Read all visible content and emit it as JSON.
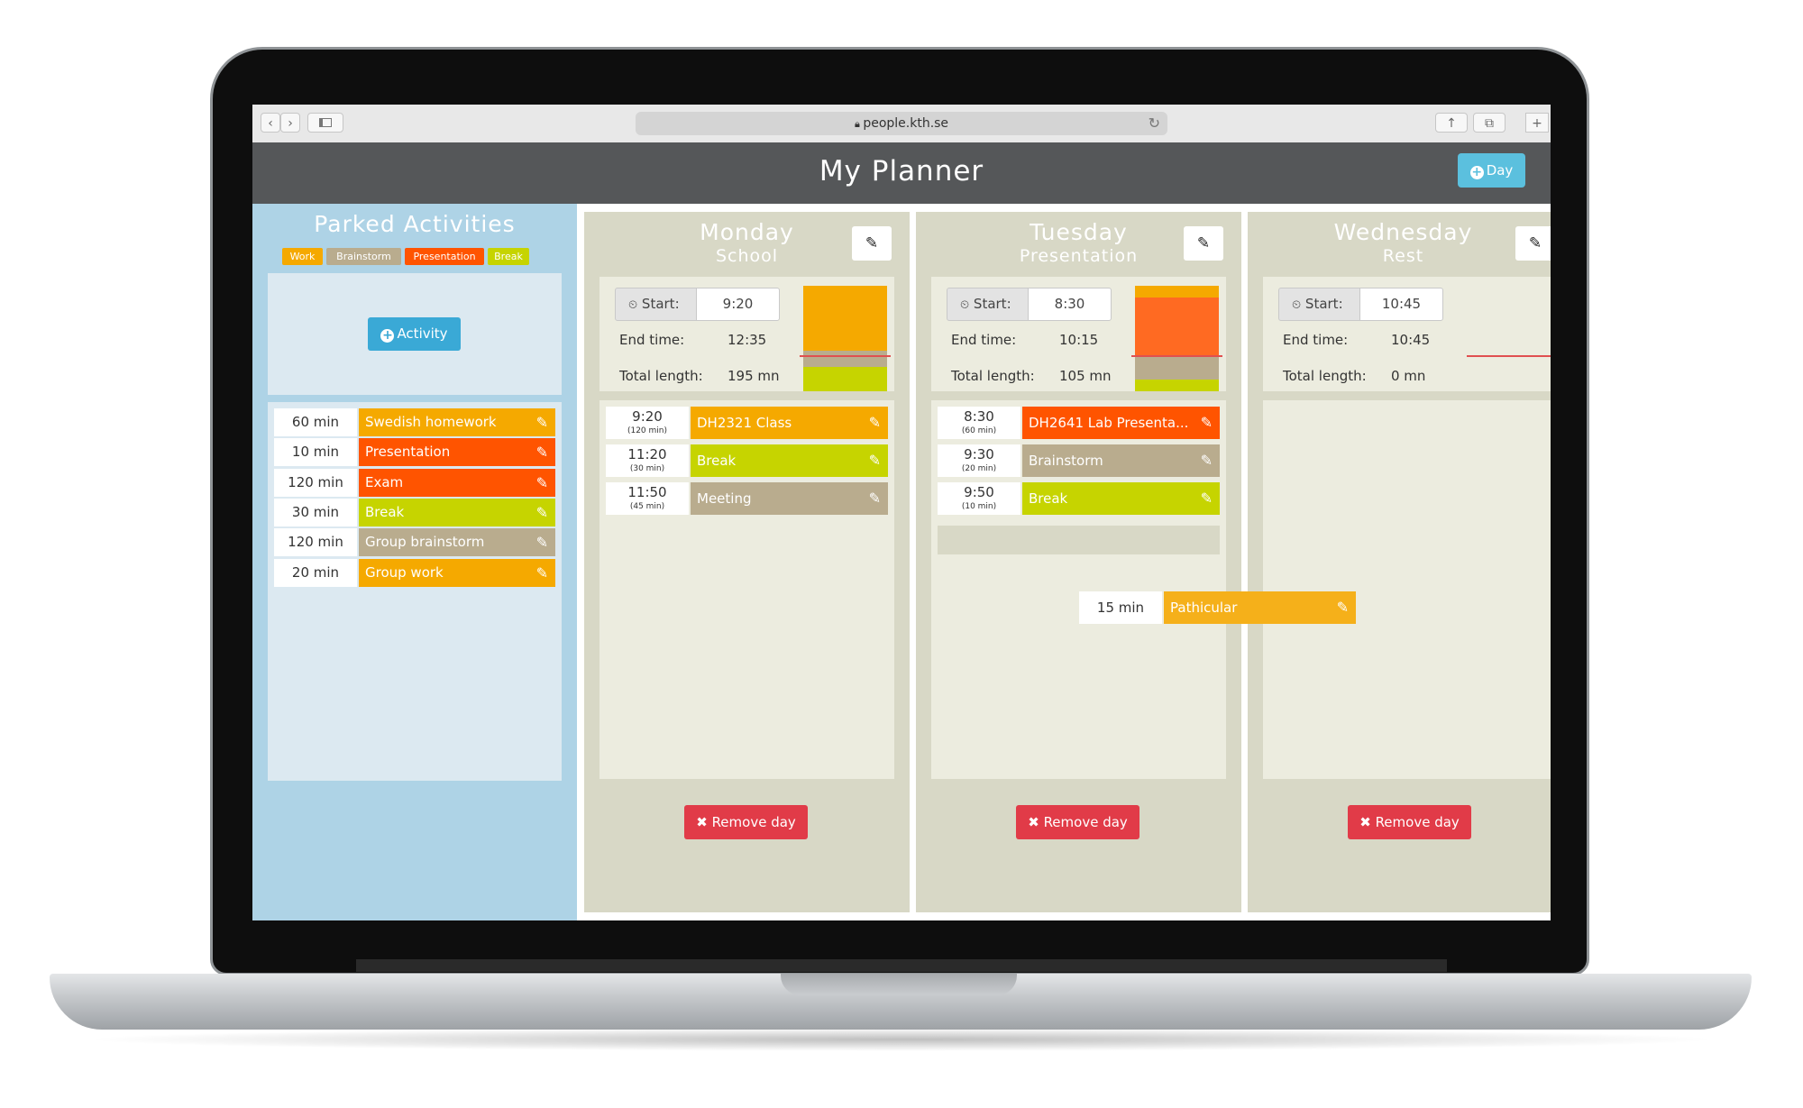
{
  "browser": {
    "url": "people.kth.se",
    "back": "‹",
    "forward": "›"
  },
  "app": {
    "title": "My Planner",
    "add_day_label": "Day"
  },
  "parked": {
    "title": "Parked Activities",
    "legend": [
      {
        "label": "Work",
        "color": "#f5a900"
      },
      {
        "label": "Brainstorm",
        "color": "#b9ac8e"
      },
      {
        "label": "Presentation",
        "color": "#ff5400"
      },
      {
        "label": "Break",
        "color": "#c6d400"
      }
    ],
    "add_activity_label": "Activity",
    "activities": [
      {
        "duration": "60 min",
        "name": "Swedish homework",
        "color": "#f5a900"
      },
      {
        "duration": "10 min",
        "name": "Presentation",
        "color": "#ff5400"
      },
      {
        "duration": "120 min",
        "name": "Exam",
        "color": "#ff5400"
      },
      {
        "duration": "30 min",
        "name": "Break",
        "color": "#c6d400"
      },
      {
        "duration": "120 min",
        "name": "Group brainstorm",
        "color": "#b9ac8e"
      },
      {
        "duration": "20 min",
        "name": "Group work",
        "color": "#f5a900"
      }
    ]
  },
  "days": [
    {
      "name": "Monday",
      "subtitle": "School",
      "start_label": "Start:",
      "start": "9:20",
      "end_label": "End time:",
      "end": "12:35",
      "total_label": "Total length:",
      "total": "195 mn",
      "composition": [
        {
          "fraction": 0.615,
          "color": "#f5a900"
        },
        {
          "fraction": 0.154,
          "color": "#b9ac8e"
        },
        {
          "fraction": 0.231,
          "color": "#c6d400"
        }
      ],
      "activities": [
        {
          "time": "9:20",
          "length": "(120 min)",
          "name": "DH2321 Class",
          "color": "#f5a900"
        },
        {
          "time": "11:20",
          "length": "(30 min)",
          "name": "Break",
          "color": "#c6d400"
        },
        {
          "time": "11:50",
          "length": "(45 min)",
          "name": "Meeting",
          "color": "#b9ac8e"
        }
      ],
      "remove_label": "Remove day"
    },
    {
      "name": "Tuesday",
      "subtitle": "Presentation",
      "start_label": "Start:",
      "start": "8:30",
      "end_label": "End time:",
      "end": "10:15",
      "total_label": "Total length:",
      "total": "105 mn",
      "composition": [
        {
          "fraction": 0.111,
          "color": "#f5a900"
        },
        {
          "fraction": 0.556,
          "color": "#ff6a22"
        },
        {
          "fraction": 0.222,
          "color": "#b9ac8e"
        },
        {
          "fraction": 0.111,
          "color": "#c6d400"
        }
      ],
      "activities": [
        {
          "time": "8:30",
          "length": "(60 min)",
          "name": "DH2641 Lab Presenta...",
          "color": "#ff5400"
        },
        {
          "time": "9:30",
          "length": "(20 min)",
          "name": "Brainstorm",
          "color": "#b9ac8e"
        },
        {
          "time": "9:50",
          "length": "(10 min)",
          "name": "Break",
          "color": "#c6d400"
        }
      ],
      "remove_label": "Remove day"
    },
    {
      "name": "Wednesday",
      "subtitle": "Rest",
      "start_label": "Start:",
      "start": "10:45",
      "end_label": "End time:",
      "end": "10:45",
      "total_label": "Total length:",
      "total": "0 mn",
      "composition": [],
      "activities": [],
      "remove_label": "Remove day"
    }
  ],
  "dragging": {
    "duration": "15 min",
    "name": "Pathicular",
    "color": "#f5b01a"
  }
}
